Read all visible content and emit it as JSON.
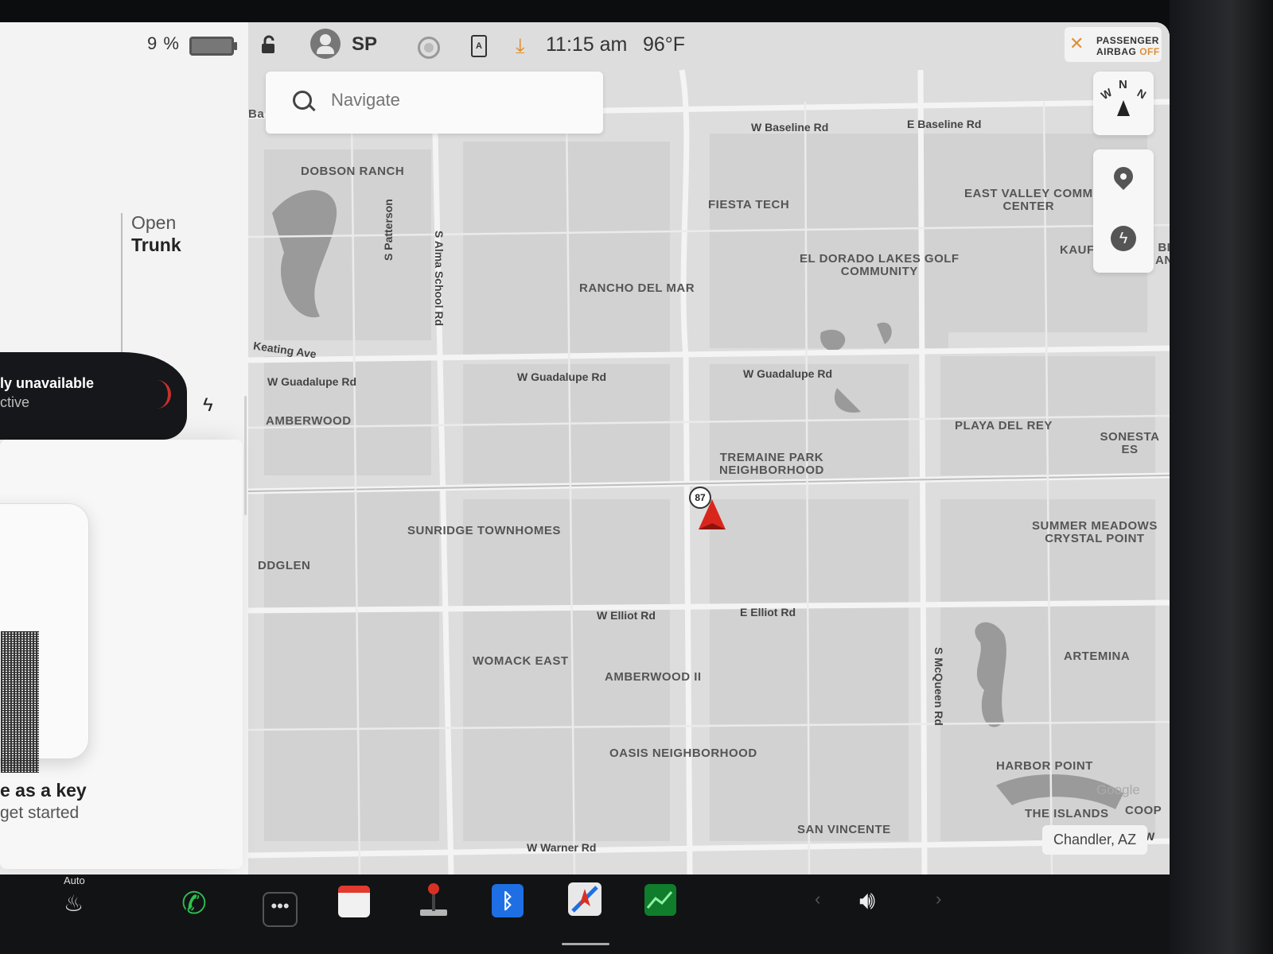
{
  "status": {
    "battery_percent": "9 %",
    "profile": "SP",
    "time": "11:15 am",
    "temperature": "96°F",
    "airbag_line1": "PASSENGER",
    "airbag_line2": "AIRBAG",
    "airbag_state": "OFF"
  },
  "left_panel": {
    "trunk_line1": "Open",
    "trunk_line2": "Trunk",
    "notice_line1": "ly unavailable",
    "notice_line2": "ctive",
    "key_title": "e as a key",
    "key_subtitle": "get started"
  },
  "search": {
    "placeholder": "Navigate"
  },
  "compass": {
    "n": "N",
    "w": "W",
    "ne": "N"
  },
  "map": {
    "location": "Chandler, AZ",
    "attribution": "Google",
    "highway_shield": "87",
    "places": [
      {
        "id": "dobson-ranch",
        "name": "DOBSON RANCH"
      },
      {
        "id": "fiesta-tech",
        "name": "FIESTA TECH"
      },
      {
        "id": "east-valley",
        "name": "EAST VALLEY COMM\nCENTER"
      },
      {
        "id": "el-dorado",
        "name": "EL DORADO LAKES GOLF\nCOMMUNITY"
      },
      {
        "id": "rancho-del-mar",
        "name": "RANCHO DEL MAR"
      },
      {
        "id": "kauf",
        "name": "KAUF"
      },
      {
        "id": "amberwood",
        "name": "AMBERWOOD"
      },
      {
        "id": "playa-del-rey",
        "name": "PLAYA DEL REY"
      },
      {
        "id": "sonesta",
        "name": "SONESTA ES"
      },
      {
        "id": "tremaine",
        "name": "TREMAINE PARK\nNEIGHBORHOOD"
      },
      {
        "id": "sunridge",
        "name": "SUNRIDGE TOWNHOMES"
      },
      {
        "id": "summer-meadows",
        "name": "SUMMER MEADOWS\nCRYSTAL POINT"
      },
      {
        "id": "oddglen",
        "name": "DDGLEN"
      },
      {
        "id": "womack",
        "name": "WOMACK EAST"
      },
      {
        "id": "amberwood-ii",
        "name": "AMBERWOOD II"
      },
      {
        "id": "artemina",
        "name": "ARTEMINA"
      },
      {
        "id": "oasis",
        "name": "OASIS NEIGHBORHOOD"
      },
      {
        "id": "harbor-point",
        "name": "HARBOR POINT"
      },
      {
        "id": "the-islands",
        "name": "THE ISLANDS"
      },
      {
        "id": "coop",
        "name": "COOP"
      },
      {
        "id": "san-vincente",
        "name": "SAN VINCENTE"
      },
      {
        "id": "ba",
        "name": "Ba"
      },
      {
        "id": "bi",
        "name": "BI\nAN"
      }
    ],
    "roads": [
      {
        "id": "w-baseline",
        "name": "W Baseline Rd"
      },
      {
        "id": "e-baseline",
        "name": "E Baseline Rd"
      },
      {
        "id": "w-guadalupe-1",
        "name": "W Guadalupe Rd"
      },
      {
        "id": "w-guadalupe-2",
        "name": "W Guadalupe Rd"
      },
      {
        "id": "w-guadalupe-3",
        "name": "W Guadalupe Rd"
      },
      {
        "id": "keating",
        "name": "Keating Ave"
      },
      {
        "id": "w-elliot",
        "name": "W Elliot Rd"
      },
      {
        "id": "e-elliot",
        "name": "E Elliot Rd"
      },
      {
        "id": "w-warner",
        "name": "W Warner Rd"
      },
      {
        "id": "s-patterson",
        "name": "S Patterson"
      },
      {
        "id": "s-alma",
        "name": "S Alma School Rd"
      },
      {
        "id": "s-mcqueen",
        "name": "S McQueen Rd"
      },
      {
        "id": "w-edge",
        "name": "W"
      }
    ]
  },
  "dock": {
    "seat_heat_label": "Auto"
  }
}
